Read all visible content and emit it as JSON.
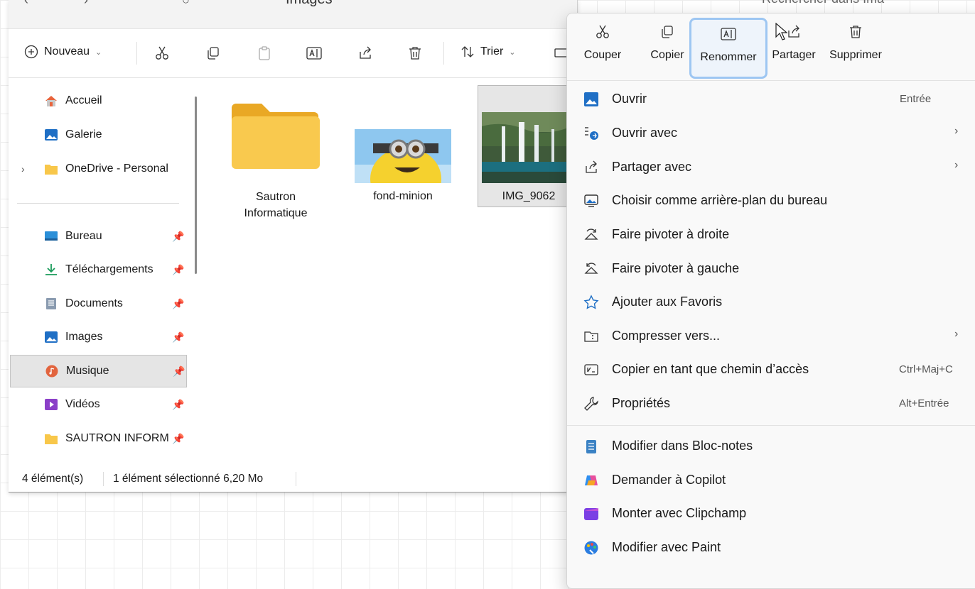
{
  "explorer": {
    "breadcrumb": "Images",
    "search_placeholder": "Rechercher dans Ima",
    "toolbar": {
      "new_label": "Nouveau",
      "sort_label": "Trier"
    },
    "sidebar": {
      "items": [
        {
          "label": "Accueil",
          "icon": "home-icon"
        },
        {
          "label": "Galerie",
          "icon": "gallery-icon"
        },
        {
          "label": "OneDrive - Personal",
          "icon": "folder-icon"
        },
        {
          "label": "Bureau",
          "icon": "desktop-icon"
        },
        {
          "label": "Téléchargements",
          "icon": "download-icon"
        },
        {
          "label": "Documents",
          "icon": "documents-icon"
        },
        {
          "label": "Images",
          "icon": "pictures-icon"
        },
        {
          "label": "Musique",
          "icon": "music-icon"
        },
        {
          "label": "Vidéos",
          "icon": "videos-icon"
        },
        {
          "label": "SAUTRON INFORM",
          "icon": "folder-icon"
        }
      ]
    },
    "files": [
      {
        "name": "Sautron\nInformatique",
        "type": "folder"
      },
      {
        "name": "fond-minion",
        "type": "image"
      },
      {
        "name": "IMG_9062",
        "type": "image",
        "selected": true
      }
    ],
    "status": {
      "count": "4 élément(s)",
      "selection": "1 élément sélectionné  6,20 Mo"
    }
  },
  "context_menu": {
    "quick_actions": [
      {
        "label": "Couper",
        "icon": "scissors-icon"
      },
      {
        "label": "Copier",
        "icon": "copy-icon"
      },
      {
        "label": "Renommer",
        "icon": "rename-icon",
        "focused": true
      },
      {
        "label": "Partager",
        "icon": "share-icon"
      },
      {
        "label": "Supprimer",
        "icon": "trash-icon"
      }
    ],
    "items": [
      {
        "label": "Ouvrir",
        "shortcut": "Entrée",
        "icon": "open-icon"
      },
      {
        "label": "Ouvrir avec",
        "submenu": true,
        "icon": "open-with-icon"
      },
      {
        "label": "Partager avec",
        "submenu": true,
        "icon": "share-icon"
      },
      {
        "label": "Choisir comme arrière-plan du bureau",
        "icon": "wallpaper-icon"
      },
      {
        "label": "Faire pivoter à droite",
        "icon": "rotate-right-icon"
      },
      {
        "label": "Faire pivoter à gauche",
        "icon": "rotate-left-icon"
      },
      {
        "label": "Ajouter aux Favoris",
        "icon": "star-icon"
      },
      {
        "label": "Compresser vers...",
        "submenu": true,
        "icon": "zip-icon"
      },
      {
        "label": "Copier en tant que chemin d’accès",
        "shortcut": "Ctrl+Maj+C",
        "icon": "path-icon"
      },
      {
        "label": "Propriétés",
        "shortcut": "Alt+Entrée",
        "icon": "wrench-icon"
      },
      {
        "label": "Modifier dans Bloc-notes",
        "icon": "notepad-icon"
      },
      {
        "label": "Demander à Copilot",
        "icon": "copilot-icon"
      },
      {
        "label": "Monter avec Clipchamp",
        "icon": "clipchamp-icon"
      },
      {
        "label": "Modifier avec Paint",
        "icon": "paint-icon"
      }
    ]
  },
  "colors": {
    "accent": "#0067c0",
    "focus_ring": "#9dc6f2",
    "folder": "#f8c74a"
  }
}
